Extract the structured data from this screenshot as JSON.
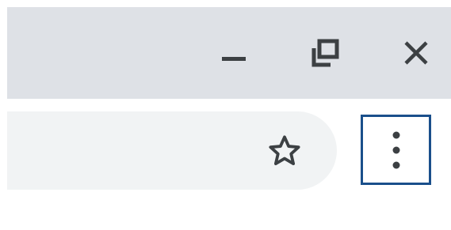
{
  "window": {
    "controls": [
      {
        "name": "minimize",
        "icon": "minimize-icon"
      },
      {
        "name": "restore",
        "icon": "restore-icon"
      },
      {
        "name": "close",
        "icon": "close-icon"
      }
    ],
    "titlebar_color": "#dee1e6"
  },
  "toolbar": {
    "omnibox_color": "#f1f3f4",
    "bookmark_icon": "star-outline-icon",
    "menu_icon": "vertical-dots-icon",
    "menu_highlight_color": "#1a4f8b"
  }
}
